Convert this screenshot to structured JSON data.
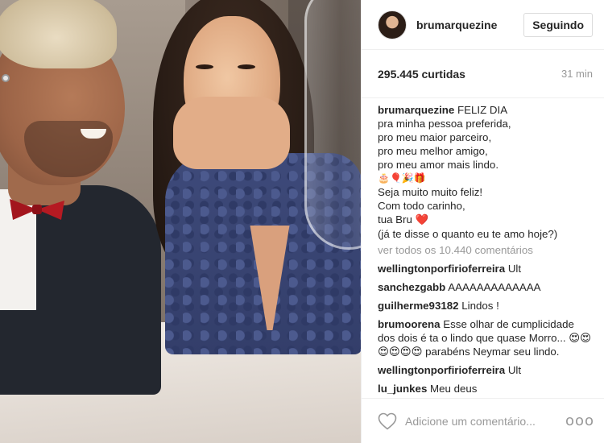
{
  "post": {
    "image_alt_icon": "photo-couple"
  },
  "header": {
    "username": "brumarquezine",
    "follow_label": "Seguindo"
  },
  "meta": {
    "likes": "295.445 curtidas",
    "time": "31 min"
  },
  "caption": {
    "author": "brumarquezine",
    "lines": [
      "FELIZ DIA",
      "pra minha pessoa preferida,",
      "pro meu maior parceiro,",
      "pro meu melhor amigo,",
      "pro meu amor mais lindo.",
      "🎂🎈🎉🎁",
      "Seja muito muito feliz!",
      "Com todo carinho,",
      "tua Bru",
      "(já te disse o quanto eu te amo hoje?)"
    ],
    "heart": "❤️"
  },
  "view_all": "ver todos os 10.440 comentários",
  "comments": [
    {
      "user": "wellingtonporfirioferreira",
      "text": "Ult"
    },
    {
      "user": "sanchezgabb",
      "text": "AAAAAAAAAAAAA"
    },
    {
      "user": "guilherme93182",
      "text": "Lindos !"
    },
    {
      "user": "brumoorena",
      "text": "Esse olhar de cumplicidade dos dois é ta o lindo que quase Morro... 😍😍😍😍😍😍 parabéns Neymar seu lindo."
    },
    {
      "user": "wellingtonporfirioferreira",
      "text": "Ult"
    },
    {
      "user": "lu_junkes",
      "text": "Meu deus"
    }
  ],
  "footer": {
    "comment_placeholder": "Adicione um comentário...",
    "more": "ooo"
  },
  "colors": {
    "heart_red": "#e0223a",
    "muted": "#999999",
    "text": "#262626"
  }
}
